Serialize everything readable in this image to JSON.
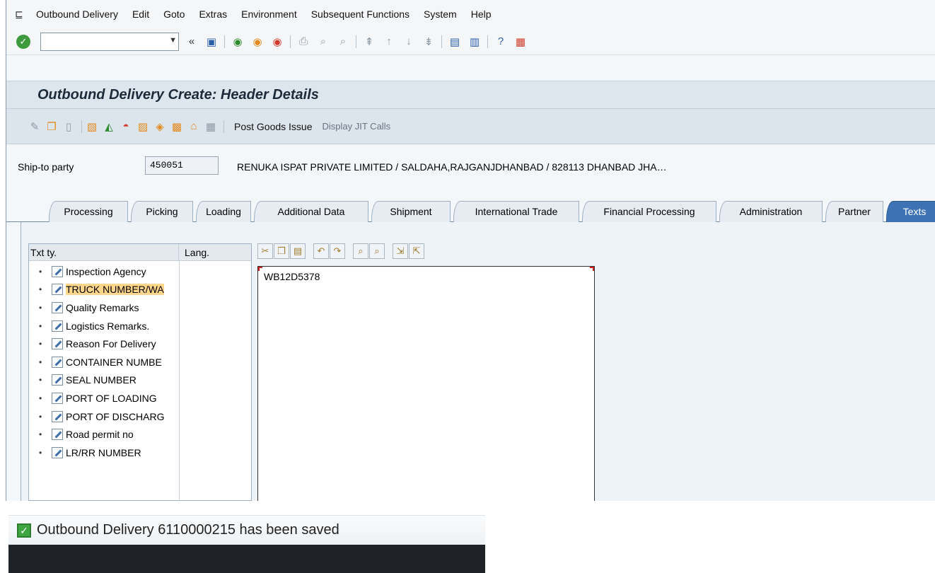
{
  "menubar": {
    "items": [
      "Outbound Delivery",
      "Edit",
      "Goto",
      "Extras",
      "Environment",
      "Subsequent Functions",
      "System",
      "Help"
    ],
    "underline": [
      "O",
      "E",
      "G",
      "a",
      "v",
      "F",
      "y",
      "H"
    ]
  },
  "stdbar": {
    "command_value": "",
    "icons": [
      "enter-icon",
      "back-arrows-icon",
      "save-icon",
      "back-icon",
      "exit-icon",
      "cancel-icon",
      "print-icon",
      "find-icon",
      "find-next-icon",
      "first-page-icon",
      "prev-page-icon",
      "next-page-icon",
      "last-page-icon",
      "create-session-icon",
      "shortcut-icon",
      "help-icon",
      "layout-menu-icon"
    ]
  },
  "title": "Outbound Delivery  Create: Header Details",
  "appbar": {
    "post_goods_issue": "Post Goods Issue",
    "display_jit_calls": "Display JIT Calls"
  },
  "header": {
    "ship_to_label": "Ship-to party",
    "ship_to_value": "450051",
    "ship_to_desc": "RENUKA ISPAT PRIVATE LIMITED / SALDAHA,RAJGANJDHANBAD / 828113 DHANBAD JHA…"
  },
  "tabs": [
    "Processing",
    "Picking",
    "Loading",
    "Additional Data",
    "Shipment",
    "International Trade",
    "Financial Processing",
    "Administration",
    "Partner",
    "Texts"
  ],
  "active_tab": "Texts",
  "texts": {
    "col_txt": "Txt ty.",
    "col_lang": "Lang.",
    "items": [
      "Inspection Agency",
      "TRUCK NUMBER/WA",
      "Quality Remarks",
      "Logistics Remarks.",
      "Reason For Delivery",
      "CONTAINER NUMBE",
      "SEAL NUMBER",
      "PORT OF LOADING",
      "PORT OF DISCHARG",
      "Road permit no",
      "LR/RR NUMBER"
    ],
    "selected_index": 1,
    "editor_value": "WB12D5378"
  },
  "status": {
    "message": "Outbound Delivery 6110000215 has been saved"
  }
}
